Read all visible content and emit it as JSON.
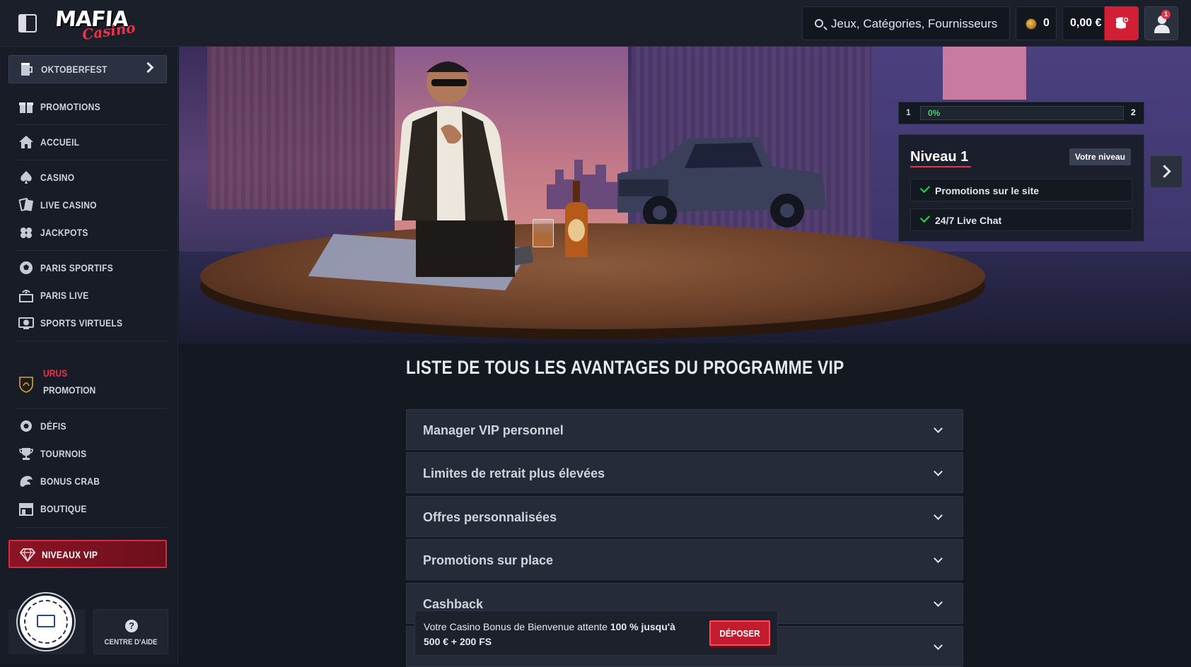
{
  "header": {
    "search_placeholder": "Jeux, Catégories, Fournisseurs",
    "coins": "0",
    "balance": "0,00 €",
    "notification_count": "1",
    "logo_top": "MAFIA",
    "logo_bottom": "Casino",
    "accent_color": "#d21f34"
  },
  "sidebar": {
    "items": [
      {
        "label": "OKTOBERFEST",
        "icon": "beer-mug-icon"
      },
      {
        "label": "PROMOTIONS",
        "icon": "gift-icon"
      },
      {
        "label": "ACCUEIL",
        "icon": "home-icon"
      },
      {
        "label": "CASINO",
        "icon": "spade-icon"
      },
      {
        "label": "LIVE CASINO",
        "icon": "live-cards-icon"
      },
      {
        "label": "JACKPOTS",
        "icon": "clover-icon"
      },
      {
        "label": "PARIS SPORTIFS",
        "icon": "soccer-ball-icon"
      },
      {
        "label": "PARIS LIVE",
        "icon": "live-broadcast-icon"
      },
      {
        "label": "SPORTS VIRTUELS",
        "icon": "virtual-sports-icon"
      },
      {
        "label": "DÉFIS",
        "icon": "gear-badge-icon"
      },
      {
        "label": "TOURNOIS",
        "icon": "trophy-icon"
      },
      {
        "label": "BONUS CRAB",
        "icon": "crab-claw-icon"
      },
      {
        "label": "BOUTIQUE",
        "icon": "shop-icon"
      },
      {
        "label": "NIVEAUX VIP",
        "icon": "diamond-icon"
      }
    ],
    "urus": {
      "line1": "URUS",
      "line2": "PROMOTION"
    },
    "help_label": "CENTRE D'AIDE",
    "help_symbol": "?"
  },
  "vip_progress": {
    "current_level_num": "1",
    "next_level_num": "2",
    "progress": 0,
    "progress_label": "0%",
    "level_title": "Niveau 1",
    "level_badge": "Votre niveau",
    "perks": [
      "Promotions sur le site",
      "24/7 Live Chat"
    ]
  },
  "content": {
    "section_title": "LISTE DE TOUS LES AVANTAGES DU PROGRAMME VIP",
    "accordion": [
      "Manager VIP personnel",
      "Limites de retrait plus élevées",
      "Offres personnalisées",
      "Promotions sur place",
      "Cashback",
      ""
    ]
  },
  "promo_bar": {
    "text_pre": "Votre Casino Bonus de Bienvenue attente ",
    "text_bold": "100 % jusqu'à 500 € + 200 FS",
    "button_label": "DÉPOSER"
  }
}
